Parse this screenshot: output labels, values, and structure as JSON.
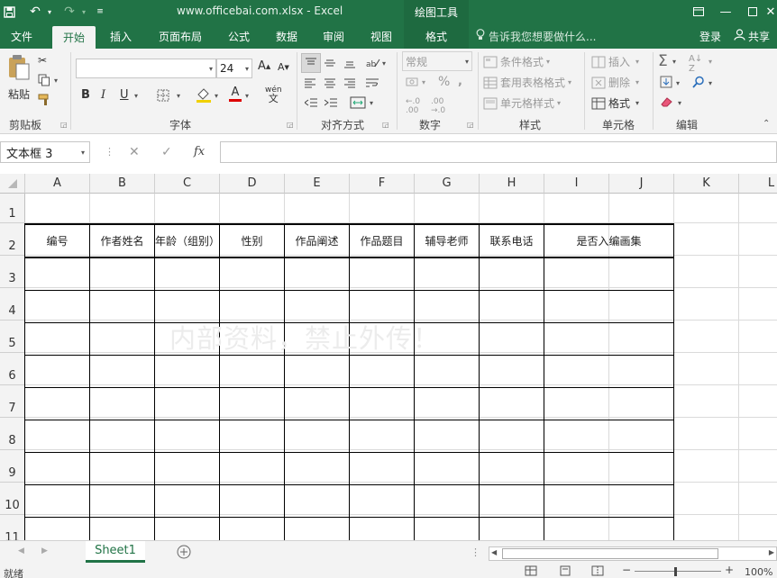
{
  "window": {
    "title": "www.officebai.com.xlsx - Excel",
    "context_tools": "绘图工具"
  },
  "tabs": {
    "file": "文件",
    "home": "开始",
    "insert": "插入",
    "page_layout": "页面布局",
    "formulas": "公式",
    "data": "数据",
    "review": "审阅",
    "view": "视图",
    "format": "格式",
    "tell_me": "告诉我您想要做什么...",
    "login": "登录",
    "share": "共享"
  },
  "ribbon": {
    "clipboard": {
      "label": "剪贴板",
      "paste": "粘贴"
    },
    "font": {
      "label": "字体",
      "font_name": "",
      "font_size": "24",
      "bold": "B",
      "italic": "I",
      "underline": "U",
      "pinyin": "wén"
    },
    "alignment": {
      "label": "对齐方式"
    },
    "number": {
      "label": "数字",
      "format": "常规"
    },
    "styles": {
      "label": "样式",
      "conditional": "条件格式",
      "table": "套用表格格式",
      "cell_styles": "单元格样式"
    },
    "cells": {
      "label": "单元格",
      "insert": "插入",
      "delete": "删除",
      "format": "格式"
    },
    "editing": {
      "label": "编辑"
    }
  },
  "formula_bar": {
    "name_box": "文本框 3",
    "fx": "fx",
    "value": ""
  },
  "grid": {
    "columns": [
      "A",
      "B",
      "C",
      "D",
      "E",
      "F",
      "G",
      "H",
      "I",
      "J",
      "K",
      "L"
    ],
    "rows": [
      "1",
      "2",
      "3",
      "4",
      "5",
      "6",
      "7",
      "8",
      "9",
      "10",
      "11"
    ],
    "table_headers": [
      "编号",
      "作者姓名",
      "年龄（组别）",
      "性别",
      "作品阐述",
      "作品题目",
      "辅导老师",
      "联系电话",
      "是否入编画集"
    ],
    "watermark": "内部资料，禁止外传！"
  },
  "sheets": {
    "active": "Sheet1"
  },
  "status": {
    "ready": "就绪",
    "zoom": "100%"
  },
  "colors": {
    "accent": "#217346"
  }
}
